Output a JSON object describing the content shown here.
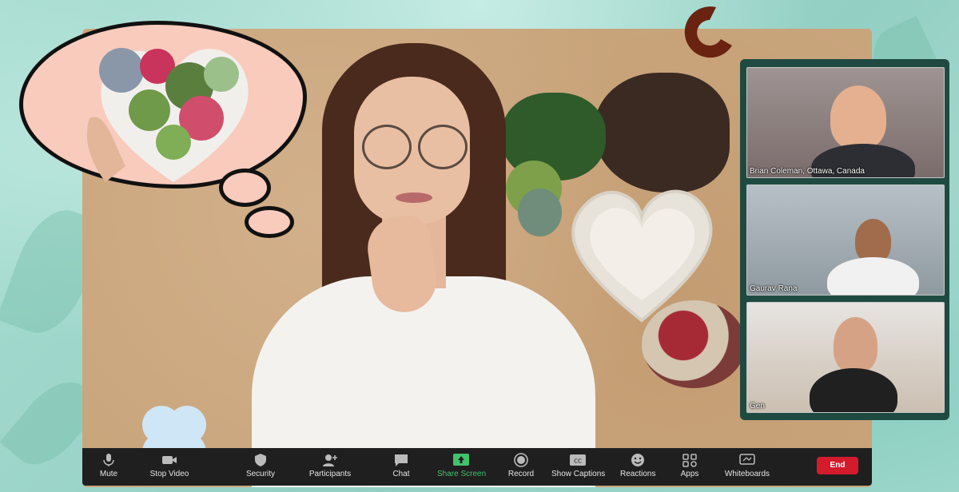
{
  "participants": [
    {
      "name": "Brian Coleman, Ottawa, Canada"
    },
    {
      "name": "Gaurav Rana"
    },
    {
      "name": "Gen"
    }
  ],
  "toolbar": {
    "mute": "Mute",
    "stop_video": "Stop Video",
    "security": "Security",
    "participants": "Participants",
    "chat": "Chat",
    "share_screen": "Share Screen",
    "record": "Record",
    "show_captions": "Show Captions",
    "reactions": "Reactions",
    "apps": "Apps",
    "whiteboards": "Whiteboards",
    "end": "End"
  },
  "icons": {
    "mute": "microphone-icon",
    "stop_video": "video-camera-icon",
    "security": "shield-icon",
    "participants": "add-person-icon",
    "chat": "speech-bubble-icon",
    "share_screen": "share-arrow-icon",
    "record": "record-circle-icon",
    "show_captions": "cc-icon",
    "reactions": "smiley-icon",
    "apps": "apps-grid-icon",
    "whiteboards": "whiteboard-icon"
  },
  "colors": {
    "end_button": "#d31b2c",
    "share_screen_accent": "#42c26c",
    "panel_background": "#1e4a42",
    "toolbar_background": "#1f1f1f"
  }
}
